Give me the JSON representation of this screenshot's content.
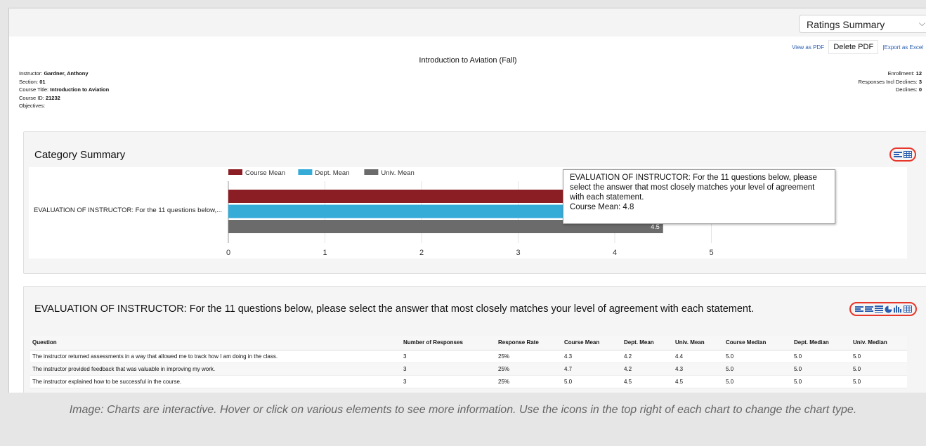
{
  "report_selector": {
    "value": "Ratings Summary",
    "caret": "⌵"
  },
  "actions": {
    "view_pdf": "View as PDF",
    "delete_pdf": "Delete PDF",
    "export_excel": "|Export as Excel"
  },
  "course_title": "Introduction to Aviation (Fall)",
  "info_left": [
    {
      "label": "Instructor: ",
      "value": "Gardner, Anthony"
    },
    {
      "label": "Section: ",
      "value": "01"
    },
    {
      "label": "Course Title: ",
      "value": "Introduction to Aviation"
    },
    {
      "label": "Course ID: ",
      "value": "21232"
    },
    {
      "label": "Objectives:",
      "value": ""
    }
  ],
  "info_right": [
    {
      "label": "Enrollment: ",
      "value": "12"
    },
    {
      "label": "Responses Incl Declines: ",
      "value": "3"
    },
    {
      "label": "Declines: ",
      "value": "0"
    }
  ],
  "category_summary": {
    "title": "Category Summary",
    "icons": [
      "bar-chart-icon",
      "table-icon"
    ],
    "tooltip": {
      "text": "EVALUATION OF INSTRUCTOR: For the 11 questions below, please select the answer that most closely matches your level of agreement with each statement.",
      "value_line": "Course Mean: 4.8"
    }
  },
  "chart_data": {
    "type": "bar",
    "orientation": "horizontal",
    "categories": [
      "EVALUATION OF INSTRUCTOR: For the 11 questions below,..."
    ],
    "series": [
      {
        "name": "Course Mean",
        "values": [
          4.8
        ],
        "color": "#8b1e24"
      },
      {
        "name": "Dept. Mean",
        "values": [
          4.6
        ],
        "color": "#35abd8"
      },
      {
        "name": "Univ. Mean",
        "values": [
          4.5
        ],
        "color": "#6b6b6b"
      }
    ],
    "data_labels": [
      "",
      "",
      "4.5"
    ],
    "x_ticks": [
      "0",
      "1",
      "2",
      "3",
      "4",
      "5"
    ],
    "xlim": [
      0,
      6
    ],
    "grid": true,
    "legend": "top"
  },
  "section": {
    "title": "EVALUATION OF INSTRUCTOR: For the 11 questions below, please select the answer that most closely matches your level of agreement with each statement.",
    "icons": [
      "bar-chart-icon",
      "stacked-bar-icon",
      "list-icon",
      "pie-chart-icon",
      "column-chart-icon",
      "table-icon"
    ],
    "columns": [
      "Question",
      "Number of Responses",
      "Response Rate",
      "Course Mean",
      "Dept. Mean",
      "Univ. Mean",
      "Course Median",
      "Dept. Median",
      "Univ. Median"
    ],
    "rows": [
      [
        "The instructor returned assessments in a way that allowed me to track how I am doing in the class.",
        "3",
        "25%",
        "4.3",
        "4.2",
        "4.4",
        "5.0",
        "5.0",
        "5.0"
      ],
      [
        "The instructor provided feedback that was valuable in improving my work.",
        "3",
        "25%",
        "4.7",
        "4.2",
        "4.3",
        "5.0",
        "5.0",
        "5.0"
      ],
      [
        "The instructor explained how to be successful in the course.",
        "3",
        "25%",
        "5.0",
        "4.5",
        "4.5",
        "5.0",
        "5.0",
        "5.0"
      ]
    ]
  },
  "caption": "Image: Charts are interactive. Hover or click on various elements to see more information. Use the icons in the top right of each chart to change the chart type.",
  "colors": {
    "accent_red": "#e8362b",
    "link_blue": "#2a5db0",
    "icon_blue": "#2a5db0"
  }
}
